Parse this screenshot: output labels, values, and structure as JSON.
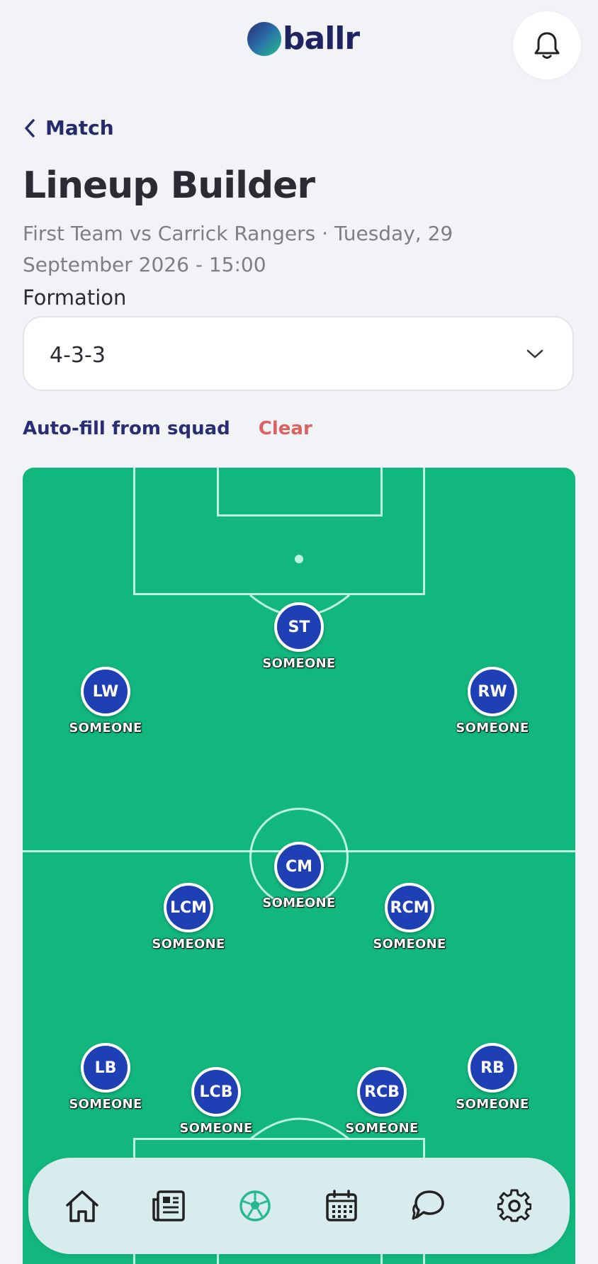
{
  "app": {
    "brand": "ballr"
  },
  "header": {
    "back_label": "Match",
    "notification_icon": "bell-icon"
  },
  "page": {
    "title": "Lineup Builder",
    "subtitle": "First Team vs Carrick Rangers · Tuesday, 29 September 2026 - 15:00"
  },
  "formation": {
    "label": "Formation",
    "value": "4-3-3"
  },
  "actions": {
    "autofill_label": "Auto-fill from squad",
    "clear_label": "Clear"
  },
  "colors": {
    "pitch": "#12b77e",
    "chip": "#1f3fb5",
    "accent": "#252a6b",
    "clear": "#d96262"
  },
  "lineup": [
    {
      "pos": "ST",
      "name": "SOMEONE"
    },
    {
      "pos": "LW",
      "name": "SOMEONE"
    },
    {
      "pos": "RW",
      "name": "SOMEONE"
    },
    {
      "pos": "CM",
      "name": "SOMEONE"
    },
    {
      "pos": "LCM",
      "name": "SOMEONE"
    },
    {
      "pos": "RCM",
      "name": "SOMEONE"
    },
    {
      "pos": "LB",
      "name": "SOMEONE"
    },
    {
      "pos": "LCB",
      "name": "SOMEONE"
    },
    {
      "pos": "RCB",
      "name": "SOMEONE"
    },
    {
      "pos": "RB",
      "name": "SOMEONE"
    }
  ],
  "nav": {
    "items": [
      {
        "icon": "home-icon"
      },
      {
        "icon": "news-icon"
      },
      {
        "icon": "football-icon",
        "active": true
      },
      {
        "icon": "calendar-icon"
      },
      {
        "icon": "chat-icon"
      },
      {
        "icon": "settings-icon"
      }
    ]
  }
}
